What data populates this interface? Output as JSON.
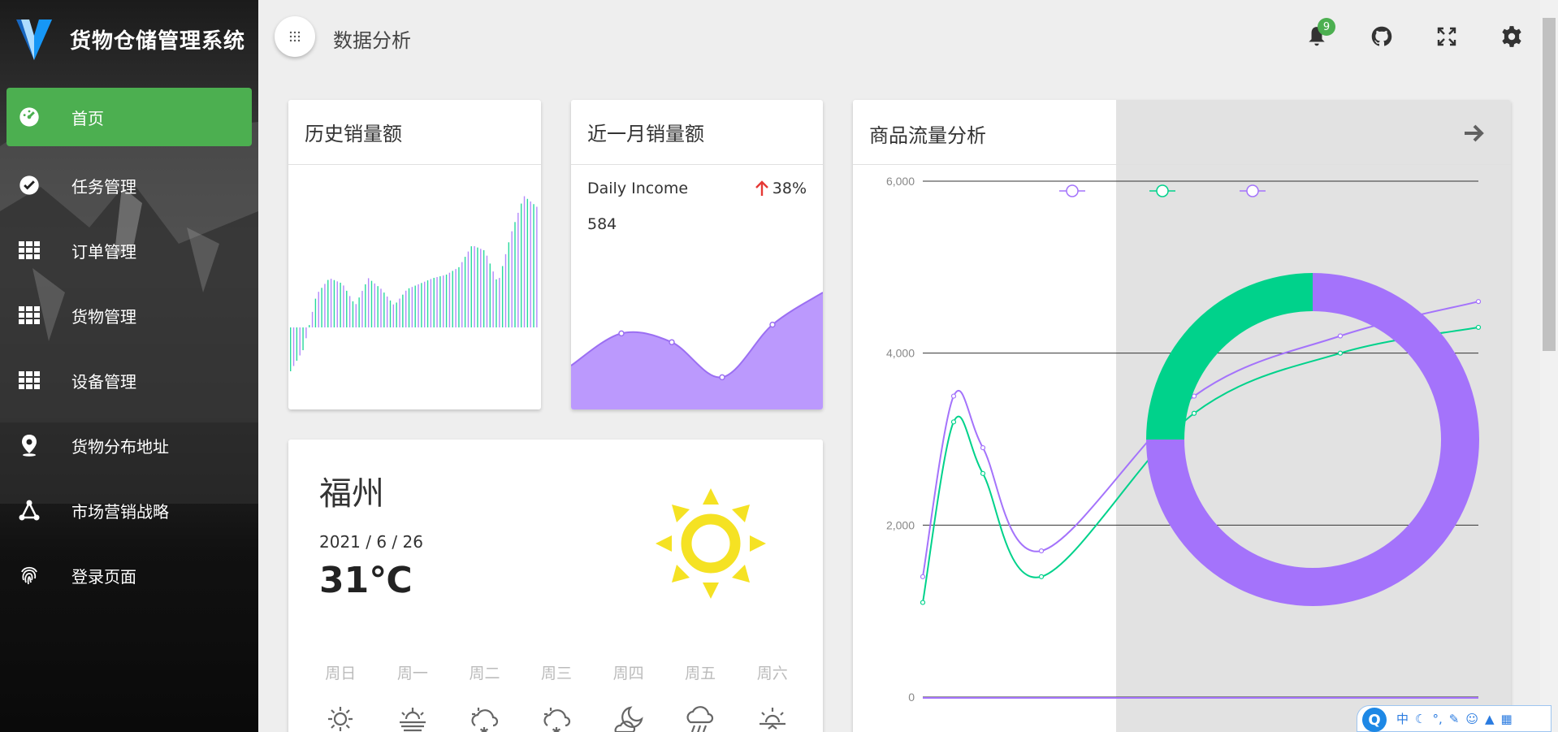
{
  "app": {
    "title": "货物仓储管理系统"
  },
  "sidebar": {
    "items": [
      {
        "label": "首页",
        "icon": "dashboard-icon",
        "active": true
      },
      {
        "label": "任务管理",
        "icon": "check-circle-icon"
      },
      {
        "label": "订单管理",
        "icon": "grid-icon"
      },
      {
        "label": "货物管理",
        "icon": "grid-icon"
      },
      {
        "label": "设备管理",
        "icon": "grid-icon"
      },
      {
        "label": "货物分布地址",
        "icon": "map-pin-icon"
      },
      {
        "label": "市场营销战略",
        "icon": "network-icon"
      },
      {
        "label": "登录页面",
        "icon": "fingerprint-icon"
      }
    ]
  },
  "header": {
    "page_title": "数据分析",
    "notification_count": "9",
    "icons": [
      "bell-icon",
      "github-icon",
      "fullscreen-icon",
      "settings-icon"
    ]
  },
  "cards": {
    "history": {
      "title": "历史销量额"
    },
    "month": {
      "title": "近一月销量额",
      "income_label": "Daily Income",
      "income_change": "38%",
      "income_value": "584"
    },
    "flow": {
      "title": "商品流量分析",
      "y_ticks": [
        "6,000",
        "4,000",
        "2,000",
        "0"
      ]
    }
  },
  "weather": {
    "city": "福州",
    "date": "2021 / 6 / 26",
    "temp": "31℃",
    "days": [
      {
        "name": "周日",
        "icon": "sun-icon"
      },
      {
        "name": "周一",
        "icon": "haze-icon"
      },
      {
        "name": "周二",
        "icon": "snow-cloud-icon"
      },
      {
        "name": "周三",
        "icon": "snow-cloud-icon"
      },
      {
        "name": "周四",
        "icon": "moon-cloud-icon"
      },
      {
        "name": "周五",
        "icon": "rain-icon"
      },
      {
        "name": "周六",
        "icon": "sunrise-icon"
      }
    ]
  },
  "tray": {
    "ime": "中"
  },
  "colors": {
    "accent": "#4caf50",
    "purple": "#a473fb",
    "green": "#00d28b",
    "sun": "#f5e223"
  },
  "chart_data": [
    {
      "type": "bar",
      "description_source": "历史销量额",
      "values": [
        -40,
        -20,
        30,
        45,
        40,
        20,
        45,
        35,
        20,
        35,
        40,
        45,
        48,
        55,
        75,
        70,
        40,
        85,
        120,
        110
      ]
    },
    {
      "type": "area",
      "description_source": "近一月销量额",
      "values": [
        30,
        52,
        46,
        22,
        58,
        80
      ]
    },
    {
      "type": "line",
      "yticks": [
        0,
        2000,
        4000,
        6000
      ],
      "ylim": [
        0,
        6000
      ],
      "series": [
        {
          "values": [
            1400,
            3500,
            2900,
            1700,
            3500,
            4200,
            4600
          ]
        },
        {
          "values": [
            1100,
            3200,
            2600,
            1400,
            3300,
            4000,
            4300
          ]
        }
      ]
    },
    {
      "type": "pie",
      "values": [
        75,
        25
      ]
    }
  ]
}
